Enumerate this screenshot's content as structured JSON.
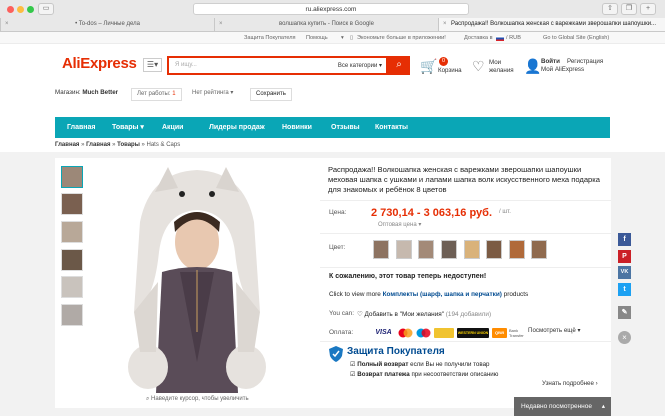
{
  "browser": {
    "url": "ru.aliexpress.com",
    "tabs": [
      {
        "label": "• To-dos – Личные дела"
      },
      {
        "label": "волшапка купить - Поиск в Google"
      },
      {
        "label": "Распродажа!! Волкошапка женская с варежками зверошапки шапоушки..."
      }
    ]
  },
  "toplinks": {
    "protection": "Защита Покупателя",
    "help": "Помощь",
    "app": "Экономьте больше в приложении!",
    "delivery": "Доставка в",
    "currency": "/ RUB",
    "global": "Go to Global Site (English)"
  },
  "header": {
    "logo": "AliExpress",
    "search_placeholder": "Я ищу...",
    "category": "Все категории",
    "cart_count": "0",
    "cart_label": "Корзина",
    "wish_line1": "Мои",
    "wish_line2": "желания",
    "login": "Войти",
    "register": "Регистрация",
    "my_ali": "Мой AliExpress"
  },
  "store": {
    "label": "Магазин:",
    "name": "Much Better",
    "years_label": "Лет работы:",
    "years": "1",
    "rating": "Нет рейтинга",
    "save": "Сохранить"
  },
  "nav": {
    "items": [
      "Главная",
      "Товары",
      "Акции",
      "Лидеры продаж",
      "Новинки",
      "Отзывы",
      "Контакты"
    ]
  },
  "breadcrumb": [
    "Главная",
    "Главная",
    "Товары",
    "Hats & Caps"
  ],
  "gallery": {
    "zoom_hint": "Наведите курсор, чтобы увеличить"
  },
  "product": {
    "title": "Распродажа!! Волкошапка женская с варежками зверошапки шапоушки меховая шапка с ушками и лапами шапка волк искусственного меха подарка для знакомых и ребёнок 8 цветов",
    "price_label": "Цена:",
    "price": "2 730,14 - 3 063,16 руб.",
    "unit": "/ шт.",
    "wholesale": "Оптовая цена",
    "color_label": "Цвет:",
    "unavailable": "К сожалению, этот товар теперь недоступен!",
    "sets_prefix": "Click to view more",
    "sets_link": "Комплекты (шарф, шапка и перчатки)",
    "sets_suffix": "products",
    "can_label": "You can:",
    "wish_add": "Добавить в \"Мои желания\"",
    "wish_count": "(194 добавили)",
    "pay_label": "Оплата:",
    "pay_methods": [
      "VISA",
      "MC",
      "Maestro",
      "WESTERN UNION",
      "QIWI",
      "Bank Transfer"
    ],
    "pay_more": "Посмотреть ещё",
    "protection_title": "Защита Покупателя",
    "protection_1_bold": "Полный возврат",
    "protection_1": "если Вы не получили товар",
    "protection_2_bold": "Возврат платежа",
    "protection_2": "при несоответствии описанию",
    "learn_more": "Узнать подробнее"
  },
  "social": [
    "f",
    "P",
    "VK",
    "t",
    "✎"
  ],
  "recent": "Недавно посмотренное",
  "colors": {
    "brand": "#e62e04",
    "nav": "#0aa6b6",
    "link": "#004b91"
  }
}
